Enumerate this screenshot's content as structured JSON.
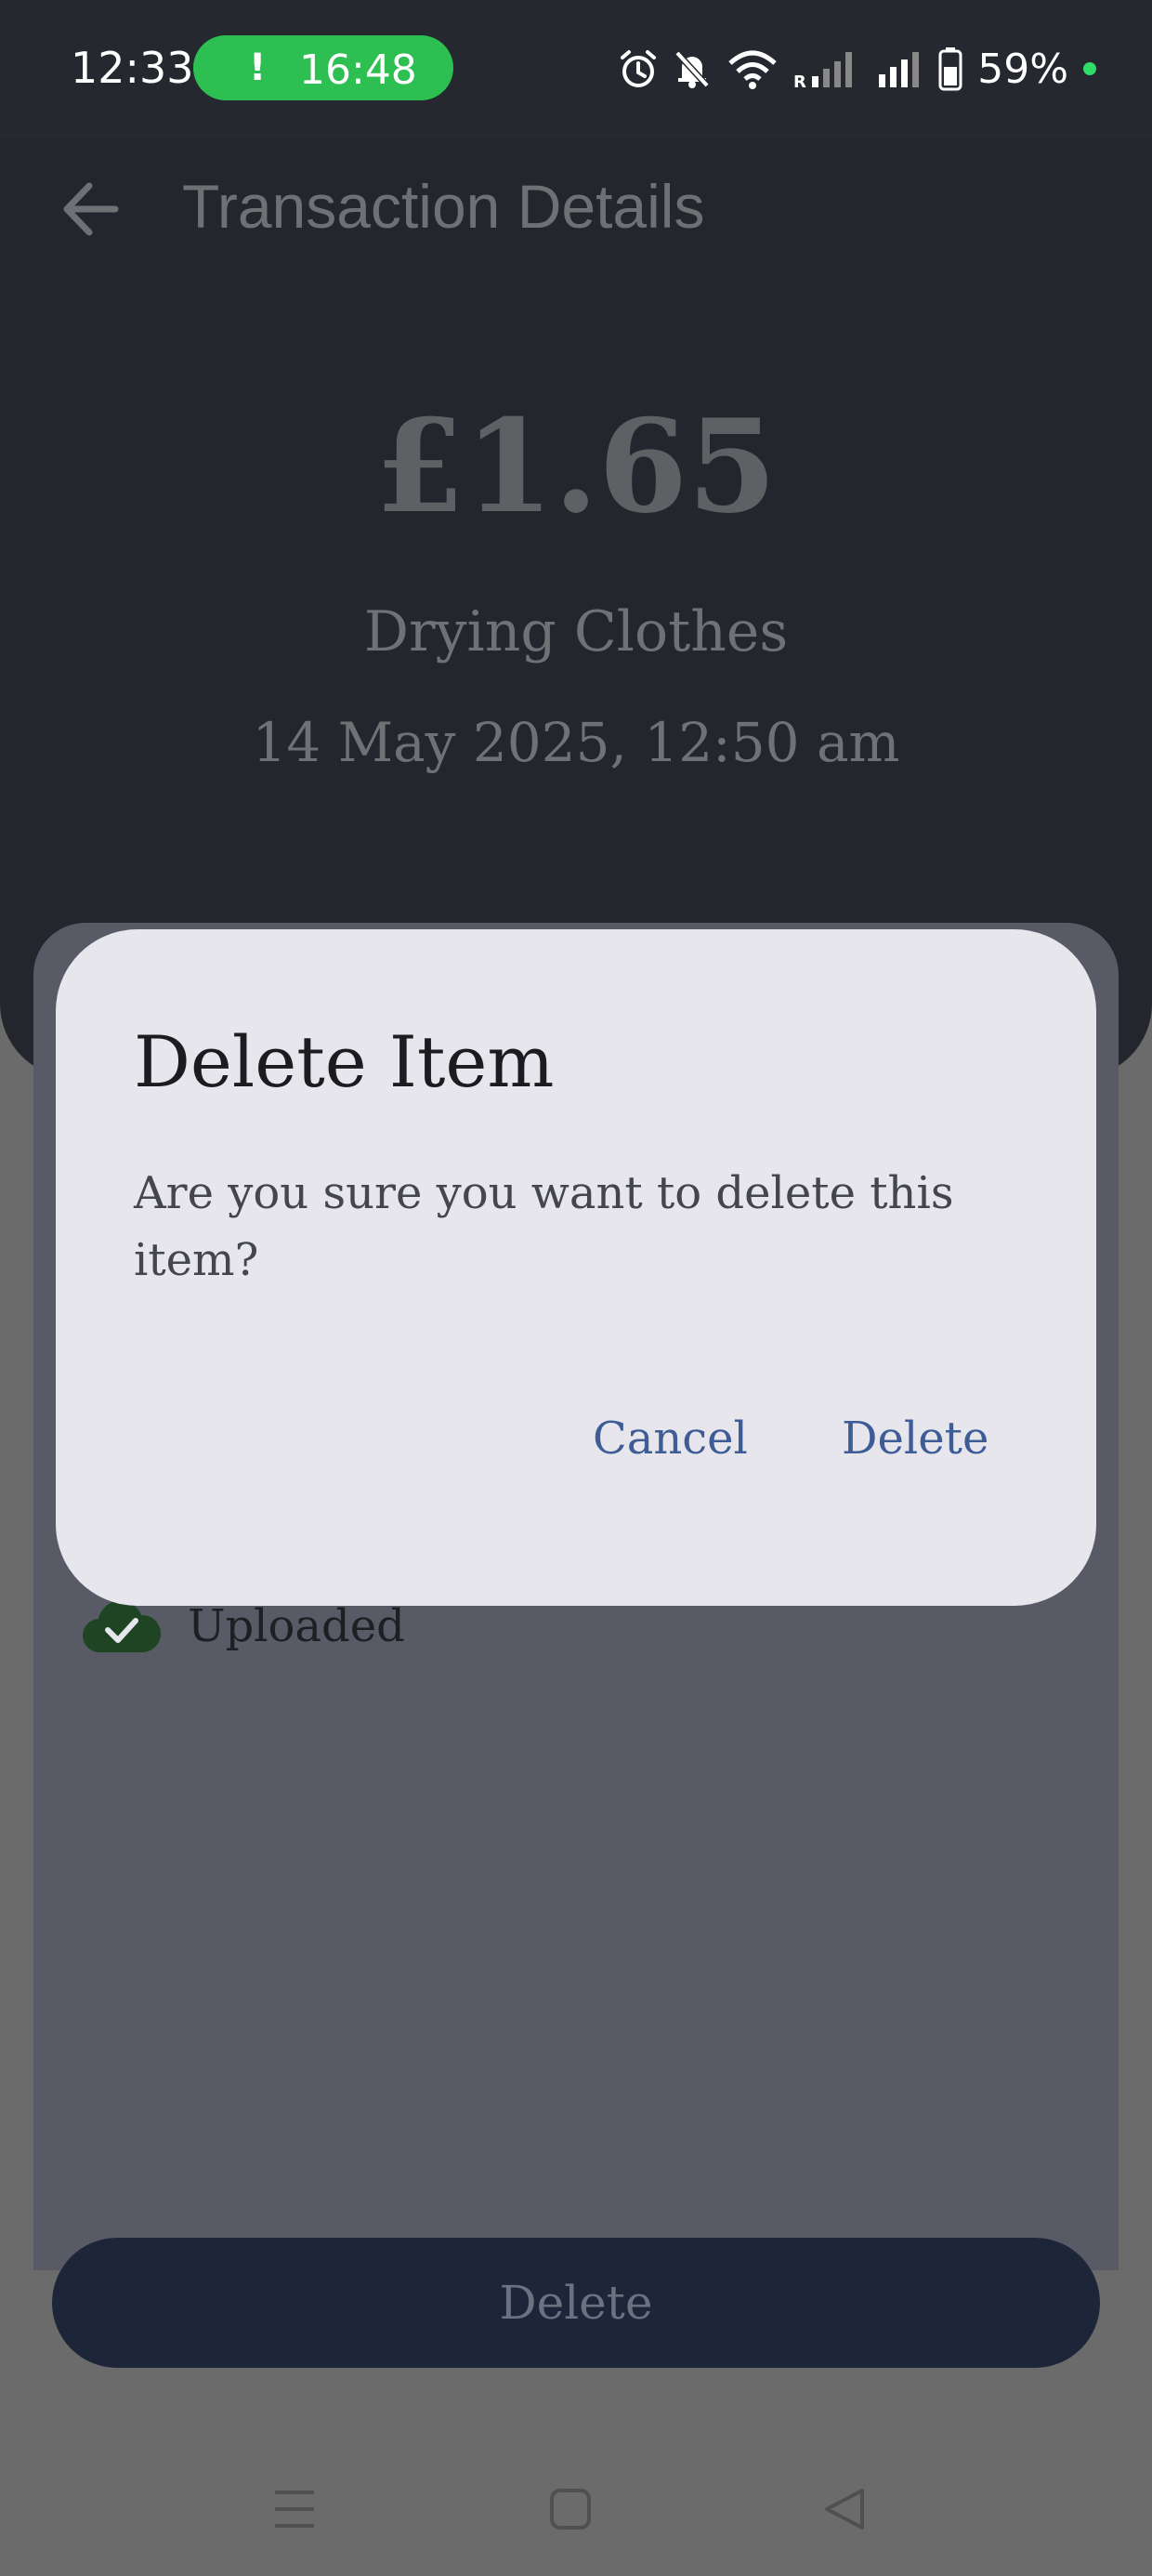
{
  "status_bar": {
    "time": "12:33",
    "call_timer": "16:48",
    "call_timer_icon": "!",
    "battery_percent": "59%",
    "icons": [
      "alarm-icon",
      "bell-off-icon",
      "wifi-icon",
      "signal-roaming-icon",
      "signal-icon",
      "battery-icon"
    ]
  },
  "header": {
    "title": "Transaction Details",
    "back_icon": "arrow-left-icon"
  },
  "transaction": {
    "amount": "£1.65",
    "category": "Drying Clothes",
    "datetime": "14 May 2025, 12:50 am"
  },
  "attachment": {
    "status_label": "Uploaded",
    "status_icon": "cloud-check-icon"
  },
  "bottom_button": {
    "label": "Delete"
  },
  "dialog": {
    "title": "Delete Item",
    "message": "Are you sure you want to delete this item?",
    "cancel_label": "Cancel",
    "confirm_label": "Delete"
  },
  "nav_bar": {
    "items": [
      "menu-icon",
      "home-icon",
      "back-icon"
    ]
  },
  "colors": {
    "scrim": "#6b6b6b",
    "hero_bg": "#23262c",
    "dialog_bg": "#e6e6ec",
    "dialog_action": "#3e5d96",
    "pill_green": "#2dbf52",
    "primary_button": "#1d2638"
  }
}
